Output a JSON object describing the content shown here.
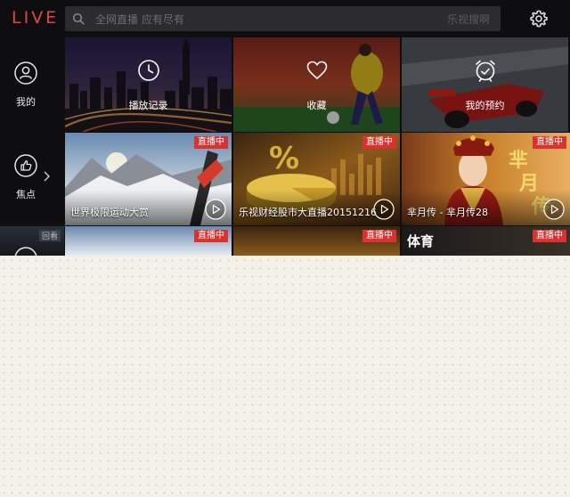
{
  "app": {
    "logo": "LIVE"
  },
  "search": {
    "placeholder": "全网直播 应有尽有",
    "hint": "乐视搜啊"
  },
  "sidebar": {
    "items": [
      {
        "label": "我的",
        "icon": "user-icon"
      },
      {
        "label": "焦点",
        "icon": "thumbs-up-icon"
      }
    ],
    "peek_tag": "回看"
  },
  "categories": [
    {
      "label": "播放记录",
      "icon": "clock-icon"
    },
    {
      "label": "收藏",
      "icon": "heart-icon"
    },
    {
      "label": "我的预约",
      "icon": "alarm-clock-icon"
    }
  ],
  "cards": [
    {
      "title": "世界极限运动大赏",
      "badge": "直播中"
    },
    {
      "title": "乐视财经股市大直播20151216",
      "badge": "直播中"
    },
    {
      "title": "芈月传 - 芈月传28",
      "badge": "直播中"
    }
  ],
  "peek_row": [
    {
      "badge": "直播中",
      "text": ""
    },
    {
      "badge": "直播中",
      "text": ""
    },
    {
      "badge": "直播中",
      "text": "体育"
    }
  ],
  "colors": {
    "accent": "#d8332f",
    "logo": "#e2463c",
    "background": "#0e0e10"
  }
}
